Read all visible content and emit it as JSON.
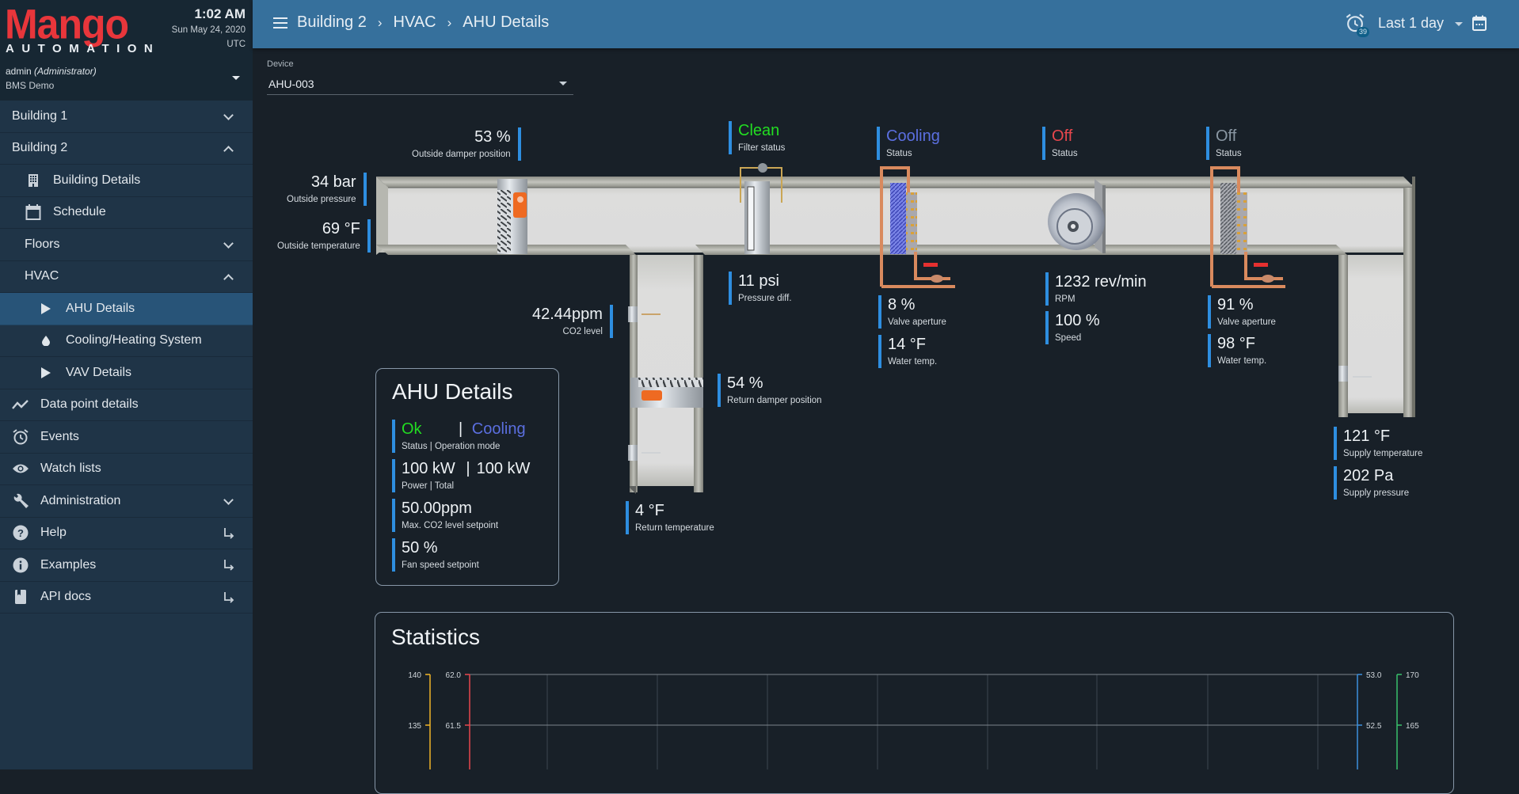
{
  "brand": {
    "name": "Mango",
    "subtitle": "AUTOMATION"
  },
  "clock": {
    "time": "1:02 AM",
    "date": "Sun May 24, 2020",
    "timezone": "UTC"
  },
  "user": {
    "name": "admin",
    "role": "(Administrator)",
    "site": "BMS Demo"
  },
  "sidebar": {
    "items": [
      {
        "label": "Building 1",
        "icon": "",
        "expand": "down"
      },
      {
        "label": "Building 2",
        "icon": "",
        "expand": "up"
      },
      {
        "label": "Building Details",
        "icon": "building-icon"
      },
      {
        "label": "Schedule",
        "icon": "calendar-icon"
      },
      {
        "label": "Floors",
        "icon": "",
        "expand": "down"
      },
      {
        "label": "HVAC",
        "icon": "",
        "expand": "up"
      },
      {
        "label": "AHU Details",
        "icon": "play-icon",
        "selected": true
      },
      {
        "label": "Cooling/Heating System",
        "icon": "water-drop-icon"
      },
      {
        "label": "VAV Details",
        "icon": "play-icon"
      },
      {
        "label": "Data point details",
        "icon": "timeline-icon"
      },
      {
        "label": "Events",
        "icon": "alarm-icon"
      },
      {
        "label": "Watch lists",
        "icon": "eye-icon"
      },
      {
        "label": "Administration",
        "icon": "wrench-icon",
        "expand": "down"
      },
      {
        "label": "Help",
        "icon": "help-icon",
        "external": true
      },
      {
        "label": "Examples",
        "icon": "info-icon",
        "external": true
      },
      {
        "label": "API docs",
        "icon": "book-icon",
        "external": true
      }
    ]
  },
  "header": {
    "breadcrumbs": [
      "Building 2",
      "HVAC",
      "AHU Details"
    ],
    "alarm_count": "39",
    "time_range": "Last 1 day"
  },
  "device": {
    "label": "Device",
    "value": "AHU-003"
  },
  "points": {
    "outside_damper": {
      "value": "53 %",
      "label": "Outside damper position"
    },
    "outside_pressure": {
      "value": "34 bar",
      "label": "Outside pressure"
    },
    "outside_temp": {
      "value": "69 °F",
      "label": "Outside temperature"
    },
    "filter_status": {
      "value": "Clean",
      "label": "Filter status"
    },
    "pressure_diff": {
      "value": "11 psi",
      "label": "Pressure diff."
    },
    "cooling_status": {
      "value": "Cooling",
      "label": "Status"
    },
    "cooling_valve": {
      "value": "8 %",
      "label": "Valve aperture"
    },
    "cooling_water": {
      "value": "14 °F",
      "label": "Water temp."
    },
    "fan_status": {
      "value": "Off",
      "label": "Status"
    },
    "fan_rpm": {
      "value": "1232 rev/min",
      "label": "RPM"
    },
    "fan_speed": {
      "value": "100 %",
      "label": "Speed"
    },
    "heating_status": {
      "value": "Off",
      "label": "Status"
    },
    "heating_valve": {
      "value": "91 %",
      "label": "Valve aperture"
    },
    "heating_water": {
      "value": "98 °F",
      "label": "Water temp."
    },
    "co2_level": {
      "value": "42.44ppm",
      "label": "CO2 level"
    },
    "return_damper": {
      "value": "54 %",
      "label": "Return damper position"
    },
    "return_temp": {
      "value": "4 °F",
      "label": "Return temperature"
    },
    "supply_temp": {
      "value": "121 °F",
      "label": "Supply temperature"
    },
    "supply_pressure": {
      "value": "202 Pa",
      "label": "Supply pressure"
    }
  },
  "ahu_details": {
    "title": "AHU Details",
    "status": "Ok",
    "mode": "Cooling",
    "status_label": "Status | Operation mode",
    "power": "100 kW",
    "total": "100 kW",
    "power_label": "Power | Total",
    "co2_setpoint": "50.00ppm",
    "co2_setpoint_label": "Max. CO2 level setpoint",
    "fan_setpoint": "50 %",
    "fan_setpoint_label": "Fan speed setpoint",
    "separator": "|"
  },
  "colors": {
    "accent": "#2e8ee0",
    "ok": "#22dd22",
    "cooling": "#5b6fe0",
    "off_alarm": "#e8474d",
    "off_inactive": "#8a97a3",
    "header": "#36709c",
    "sidebar": "#1f3447"
  },
  "statistics": {
    "title": "Statistics",
    "chart_data": {
      "type": "line",
      "title": "Statistics",
      "axes": [
        {
          "name": "left-outer",
          "color": "#f0b429",
          "ticks": [
            140,
            135
          ]
        },
        {
          "name": "left-inner",
          "color": "#e8474d",
          "ticks": [
            "62.0",
            "61.5"
          ]
        },
        {
          "name": "right-inner",
          "color": "#3c91dd",
          "ticks": [
            "53.0",
            "52.5"
          ]
        },
        {
          "name": "right-outer",
          "color": "#39c06b",
          "ticks": [
            170,
            165
          ]
        }
      ],
      "grid": true,
      "series": []
    }
  }
}
